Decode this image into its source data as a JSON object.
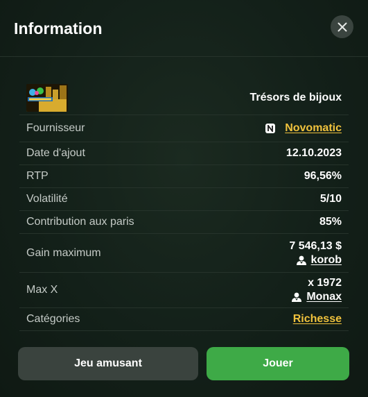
{
  "header": {
    "title": "Information"
  },
  "game": {
    "name": "Trésors de bijoux"
  },
  "rows": {
    "provider": {
      "label": "Fournisseur",
      "value": "Novomatic"
    },
    "date": {
      "label": "Date d'ajout",
      "value": "12.10.2023"
    },
    "rtp": {
      "label": "RTP",
      "value": "96,56%"
    },
    "volatility": {
      "label": "Volatilité",
      "value": "5/10"
    },
    "contribution": {
      "label": "Contribution aux paris",
      "value": "85%"
    },
    "max_win": {
      "label": "Gain maximum",
      "value": "7 546,13 $",
      "user": "korob"
    },
    "max_x": {
      "label": "Max X",
      "value": "x 1972",
      "user": "Monax"
    },
    "categories": {
      "label": "Catégories",
      "value": "Richesse"
    }
  },
  "buttons": {
    "demo": "Jeu amusant",
    "play": "Jouer"
  },
  "colors": {
    "accent_link": "#f0c23d",
    "play_button": "#3eaa47",
    "demo_button": "#3a433e"
  }
}
